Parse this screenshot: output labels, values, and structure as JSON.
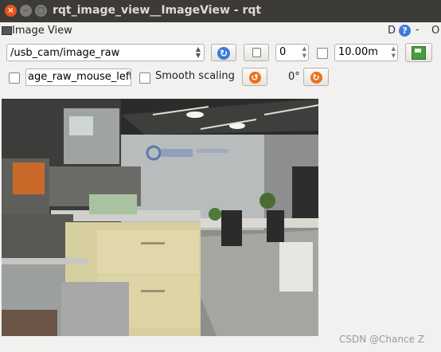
{
  "window": {
    "title": "rqt_image_view__ImageView - rqt",
    "close_glyph": "×",
    "min_glyph": "–",
    "max_glyph": "□"
  },
  "dock": {
    "title": "Image View",
    "d_label": "D",
    "help_label": "?",
    "dash_label": "-",
    "o_label": "O"
  },
  "toolbar": {
    "topic": "/usb_cam/image_raw",
    "refresh_icon": "refresh-icon",
    "value_spin": "0",
    "zoom_value": "10.00m",
    "mouse_topic": "age_raw_mouse_left",
    "smooth_label": "Smooth scaling",
    "rotation": "0°"
  },
  "colors": {
    "titlebar": "#3c3b37",
    "close": "#e95420",
    "accent_blue": "#3a7bd5",
    "rotate_orange": "#e8721c"
  },
  "watermark": "CSDN @Chance Z"
}
